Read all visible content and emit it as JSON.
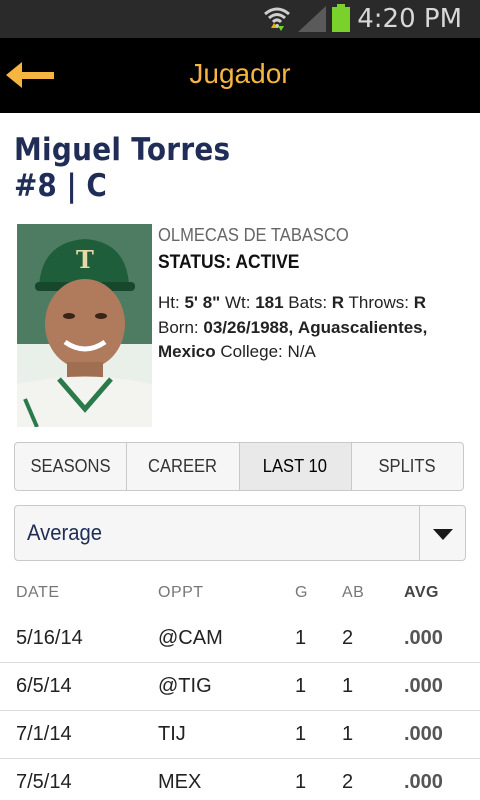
{
  "status_bar": {
    "time": "4:20 PM"
  },
  "header": {
    "title": "Jugador"
  },
  "player": {
    "name": "Miguel Torres",
    "number_position": "#8 | C",
    "team": "OLMECAS DE TABASCO",
    "status": "STATUS: ACTIVE",
    "ht_label": "Ht:",
    "ht": "5' 8\"",
    "wt_label": "Wt:",
    "wt": "181",
    "bats_label": "Bats:",
    "bats": "R",
    "throws_label": "Throws:",
    "throws": "R",
    "born_label": "Born:",
    "born_date": "03/26/1988,",
    "born_city": "Aguascalientes,",
    "born_country": "Mexico",
    "college_label": "College:",
    "college": "N/A"
  },
  "tabs": [
    {
      "label": "SEASONS"
    },
    {
      "label": "CAREER"
    },
    {
      "label": "LAST 10"
    },
    {
      "label": "SPLITS"
    }
  ],
  "dropdown": {
    "selected": "Average"
  },
  "table": {
    "headers": {
      "date": "DATE",
      "oppt": "OPPT",
      "g": "G",
      "ab": "AB",
      "avg": "AVG"
    },
    "rows": [
      {
        "date": "5/16/14",
        "oppt": "@CAM",
        "g": "1",
        "ab": "2",
        "avg": ".000"
      },
      {
        "date": "6/5/14",
        "oppt": "@TIG",
        "g": "1",
        "ab": "1",
        "avg": ".000"
      },
      {
        "date": "7/1/14",
        "oppt": "TIJ",
        "g": "1",
        "ab": "1",
        "avg": ".000"
      },
      {
        "date": "7/5/14",
        "oppt": "MEX",
        "g": "1",
        "ab": "2",
        "avg": ".000"
      }
    ]
  },
  "colors": {
    "accent": "#f5b53f",
    "navy": "#1f2d57",
    "header_bg": "#000000"
  }
}
